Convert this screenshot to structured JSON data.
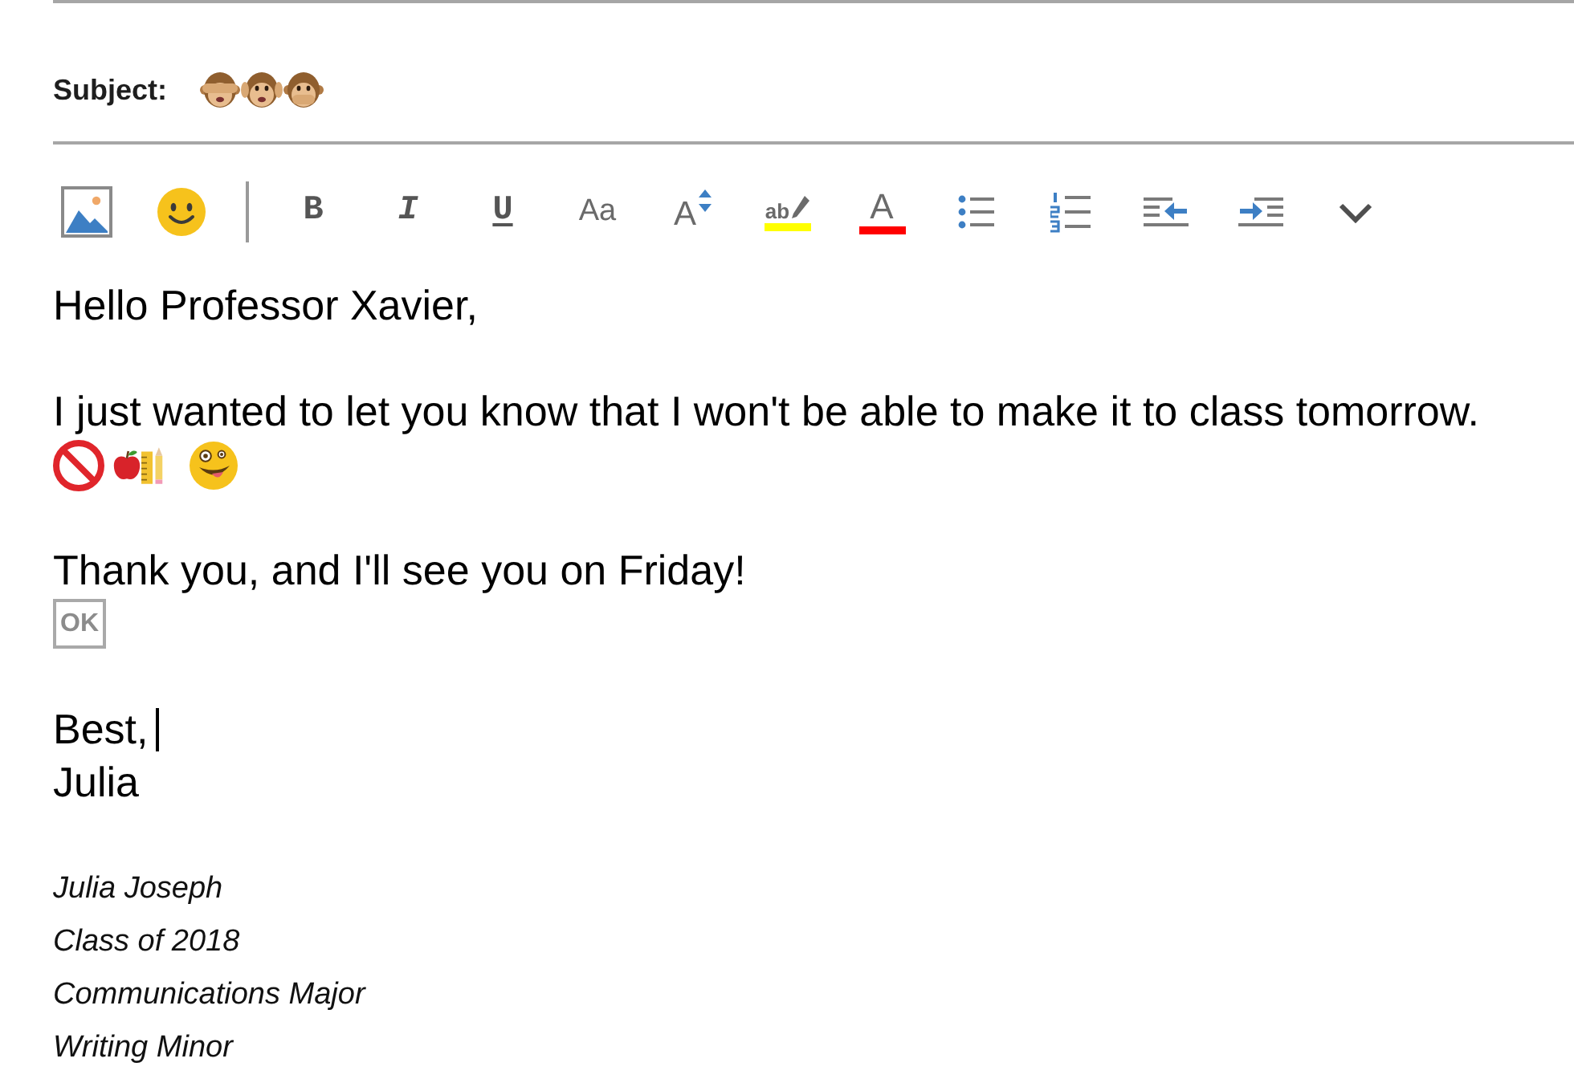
{
  "subject": {
    "label": "Subject:"
  },
  "toolbar": [
    {
      "kind": "insert-picture"
    },
    {
      "kind": "emoji"
    },
    {
      "kind": "separator"
    },
    {
      "kind": "bold",
      "label": "B"
    },
    {
      "kind": "italic",
      "label": "I"
    },
    {
      "kind": "underline",
      "label": "U"
    },
    {
      "kind": "font",
      "label": "Aa"
    },
    {
      "kind": "font-size",
      "label": "A"
    },
    {
      "kind": "highlight",
      "label": "ab",
      "color": "#ffff00"
    },
    {
      "kind": "font-color",
      "label": "A",
      "color": "#ff0000"
    },
    {
      "kind": "bullets"
    },
    {
      "kind": "numbering"
    },
    {
      "kind": "outdent"
    },
    {
      "kind": "indent"
    },
    {
      "kind": "more"
    }
  ],
  "body": [
    {
      "kind": "text",
      "text": "Hello Professor Xavier,",
      "cursor": false
    },
    {
      "kind": "blank"
    },
    {
      "kind": "text",
      "text": "I just wanted to let you know that I won't be able to make it to class tomorrow.",
      "cursor": false
    },
    {
      "kind": "emoji-row"
    },
    {
      "kind": "blank"
    },
    {
      "kind": "text",
      "text": "Thank you, and I'll see you on Friday!",
      "cursor": false
    },
    {
      "kind": "ok-symbol",
      "label": "OK"
    },
    {
      "kind": "blank"
    },
    {
      "kind": "text",
      "text": "Best,",
      "cursor": true
    },
    {
      "kind": "text",
      "text": "Julia",
      "cursor": false
    }
  ],
  "signature": {
    "lines": [
      "Julia Joseph",
      "Class of 2018",
      "Communications Major",
      "Writing Minor"
    ]
  }
}
